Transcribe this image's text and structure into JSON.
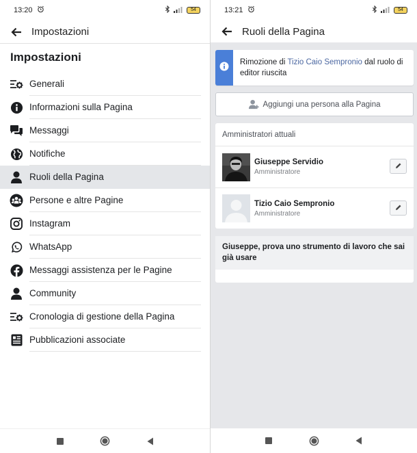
{
  "left": {
    "status_time": "13:20",
    "battery": "54",
    "appbar_title": "Impostazioni",
    "section_title": "Impostazioni",
    "menu": [
      {
        "label": "Generali"
      },
      {
        "label": "Informazioni sulla Pagina"
      },
      {
        "label": "Messaggi"
      },
      {
        "label": "Notifiche"
      },
      {
        "label": "Ruoli della Pagina"
      },
      {
        "label": "Persone e altre Pagine"
      },
      {
        "label": "Instagram"
      },
      {
        "label": "WhatsApp"
      },
      {
        "label": "Messaggi assistenza per le Pagine"
      },
      {
        "label": "Community"
      },
      {
        "label": "Cronologia di gestione della Pagina"
      },
      {
        "label": "Pubblicazioni associate"
      }
    ],
    "active_item": "Ruoli della Pagina"
  },
  "right": {
    "status_time": "13:21",
    "battery": "54",
    "appbar_title": "Ruoli della Pagina",
    "toast": {
      "prefix": "Rimozione di ",
      "link": "Tizio Caio Sempronio",
      "suffix": " dal ruolo di editor riuscita"
    },
    "add_button_label": "Aggiungi una persona alla Pagina",
    "admins_title": "Amministratori attuali",
    "admins": [
      {
        "name": "Giuseppe Servidio",
        "role": "Amministratore"
      },
      {
        "name": "Tizio Caio Sempronio",
        "role": "Amministratore"
      }
    ],
    "suggestion_title": "Giuseppe, prova uno strumento di lavoro che sai già usare"
  },
  "colors": {
    "accent_blue": "#4a7fd8",
    "link_blue": "#4b67a1",
    "active_row": "#e4e6e9",
    "right_bg": "#e6e7ea"
  }
}
